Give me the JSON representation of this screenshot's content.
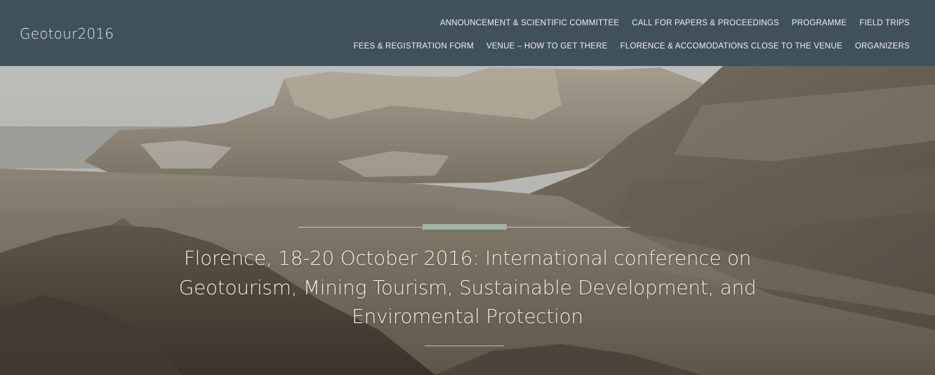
{
  "site": {
    "brand": "Geotour2016"
  },
  "nav": {
    "row1": [
      "ANNOUNCEMENT & SCIENTIFIC COMMITTEE",
      "CALL FOR PAPERS & PROCEEDINGS",
      "PROGRAMME",
      "FIELD TRIPS"
    ],
    "row2": [
      "FEES & REGISTRATION FORM",
      "VENUE – HOW TO GET THERE",
      "FLORENCE & ACCOMODATIONS CLOSE TO THE VENUE",
      "ORGANIZERS"
    ]
  },
  "hero": {
    "headline": "Florence, 18-20 October 2016: International conference on Geotourism, Mining Tourism, Sustainable Development, and Enviromental Protection"
  },
  "colors": {
    "topbar": "#344852",
    "accent_bar": "#9eb6a8",
    "text_light": "#eef2f3"
  }
}
